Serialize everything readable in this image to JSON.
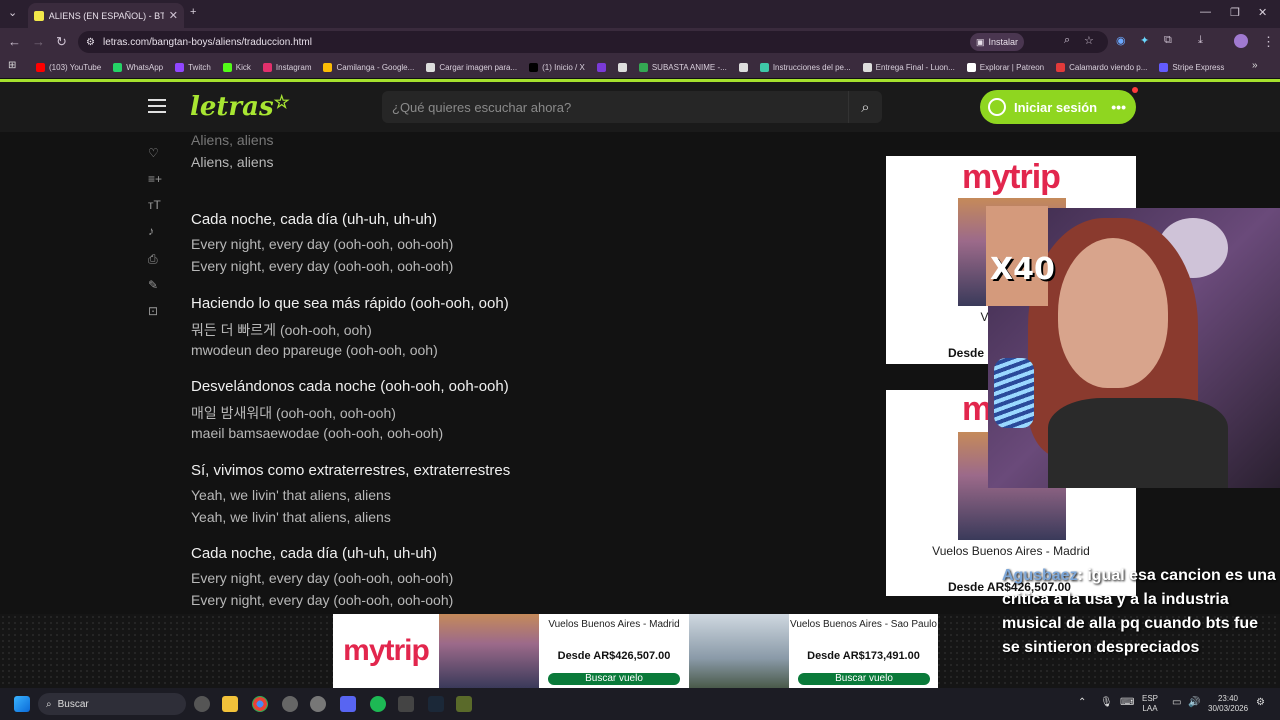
{
  "browser": {
    "tab_title": "ALIENS (EN ESPAÑOL) - BTS - L",
    "url": "letras.com/bangtan-boys/aliens/traduccion.html",
    "install_label": "Instalar",
    "bookmarks": [
      {
        "label": "(103) YouTube",
        "color": "#ff0000"
      },
      {
        "label": "WhatsApp",
        "color": "#25d366"
      },
      {
        "label": "Twitch",
        "color": "#9146ff"
      },
      {
        "label": "Kick",
        "color": "#53fc18"
      },
      {
        "label": "Instagram",
        "color": "#e1306c"
      },
      {
        "label": "Camilanga - Google...",
        "color": "#fbbc05"
      },
      {
        "label": "Cargar imagen para...",
        "color": "#dddddd"
      },
      {
        "label": "(1) Inicio / X",
        "color": "#000000"
      },
      {
        "label": "",
        "color": "#7a3ad8"
      },
      {
        "label": "",
        "color": "#dddddd"
      },
      {
        "label": "SUBASTA ANIME -...",
        "color": "#34a853"
      },
      {
        "label": "",
        "color": "#dddddd"
      },
      {
        "label": "Instrucciones del pe...",
        "color": "#3ec8a8"
      },
      {
        "label": "Entrega Final - Luon...",
        "color": "#dddddd"
      },
      {
        "label": "Explorar | Patreon",
        "color": "#ffffff"
      },
      {
        "label": "Calamardo viendo p...",
        "color": "#e23a3a"
      },
      {
        "label": "Stripe Express",
        "color": "#635bff"
      }
    ]
  },
  "site": {
    "logo": "letras",
    "search_placeholder": "¿Qué quieres escuchar ahora?",
    "login_label": "Iniciar sesión",
    "accent": "#8fd620"
  },
  "lyrics": [
    {
      "text": "Aliens, aliens",
      "kind": "faded"
    },
    {
      "text": "Aliens, aliens",
      "kind": "tr"
    },
    {
      "text": "Cada noche, cada día (uh-uh, uh-uh)",
      "kind": "es"
    },
    {
      "text": "Every night, every day (ooh-ooh, ooh-ooh)",
      "kind": "tr"
    },
    {
      "text": "Every night, every day (ooh-ooh, ooh-ooh)",
      "kind": "tr"
    },
    {
      "text": "Haciendo lo que sea más rápido (ooh-ooh, ooh)",
      "kind": "es"
    },
    {
      "text": "뭐든 더 빠르게 (ooh-ooh, ooh)",
      "kind": "tr"
    },
    {
      "text": "mwodeun deo ppareuge (ooh-ooh, ooh)",
      "kind": "tr"
    },
    {
      "text": "Desvelándonos cada noche (ooh-ooh, ooh-ooh)",
      "kind": "es"
    },
    {
      "text": "매일 밤새워대 (ooh-ooh, ooh-ooh)",
      "kind": "tr"
    },
    {
      "text": "maeil bamsaewodae (ooh-ooh, ooh-ooh)",
      "kind": "tr"
    },
    {
      "text": "Sí, vivimos como extraterrestres, extraterrestres",
      "kind": "es"
    },
    {
      "text": "Yeah, we livin' that aliens, aliens",
      "kind": "tr"
    },
    {
      "text": "Yeah, we livin' that aliens, aliens",
      "kind": "tr"
    },
    {
      "text": "Cada noche, cada día (uh-uh, uh-uh)",
      "kind": "es"
    },
    {
      "text": "Every night, every day (ooh-ooh, ooh-ooh)",
      "kind": "tr"
    },
    {
      "text": "Every night, every day (ooh-ooh, ooh-ooh)",
      "kind": "tr"
    }
  ],
  "ads": {
    "brand": "mytrip",
    "side1_title": "Vuelos Bue",
    "side1_price": "Desde",
    "side2_title": "Vuelos Buenos Aires - Madrid",
    "side2_price": "Desde AR$426,507.00",
    "bottom": [
      {
        "title": "Vuelos Buenos Aires - Madrid",
        "price": "Desde AR$426,507.00",
        "button": "Buscar vuelo"
      },
      {
        "title": "Vuelos Buenos Aires - Sao Paulo",
        "price": "Desde AR$173,491.00",
        "button": "Buscar vuelo"
      }
    ]
  },
  "overlay": {
    "multiplier": "X40"
  },
  "chat": {
    "user": "Agusbaez",
    "message": ": igual esa cancion es una critica a la usa y a la industria musical de alla pq cuando bts fue se sintieron despreciados"
  },
  "taskbar": {
    "search_label": "Buscar",
    "lang": "ESP",
    "lang_sub": "LAA",
    "time": "23:40",
    "date": "30/03/2026"
  }
}
